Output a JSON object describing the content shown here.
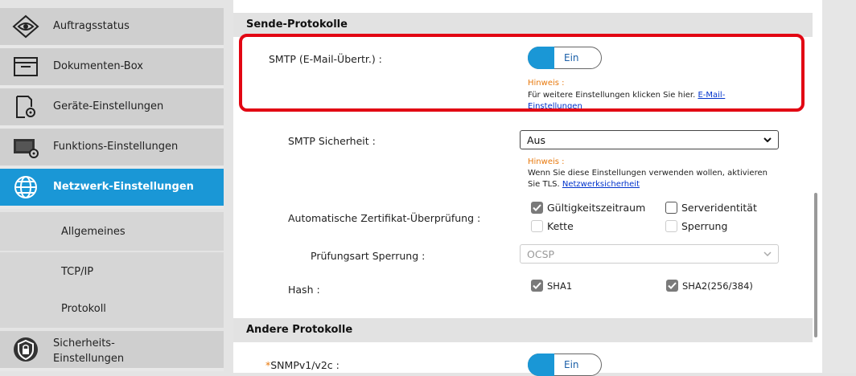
{
  "sidebar": {
    "items": [
      {
        "label": "Auftragsstatus",
        "icon": "eye-icon"
      },
      {
        "label": "Dokumenten-Box",
        "icon": "folder-icon"
      },
      {
        "label": "Geräte-Einstellungen",
        "icon": "device-settings-icon"
      },
      {
        "label": "Funktions-Einstellungen",
        "icon": "function-settings-icon"
      },
      {
        "label": "Netzwerk-Einstellungen",
        "icon": "globe-icon"
      }
    ],
    "sub_items": [
      {
        "label": "Allgemeines"
      },
      {
        "label": "TCP/IP"
      },
      {
        "label": "Protokoll"
      }
    ],
    "security": {
      "label_line1": "Sicherheits-",
      "label_line2": "Einstellungen",
      "icon": "shield-lock-icon"
    }
  },
  "main": {
    "section_send": "Sende-Protokolle",
    "smtp": {
      "label": "SMTP (E-Mail-Übertr.) :",
      "toggle": "Ein",
      "hint_title": "Hinweis :",
      "hint_text": "Für weitere Einstellungen klicken Sie hier.",
      "hint_link": "E-Mail-Einstellungen"
    },
    "smtp_security": {
      "label": "SMTP Sicherheit :",
      "value": "Aus",
      "hint_title": "Hinweis :",
      "hint_text_1": "Wenn Sie diese Einstellungen verwenden wollen, aktivieren",
      "hint_text_2": "Sie TLS.",
      "hint_link": "Netzwerksicherheit"
    },
    "auto_cert": {
      "label": "Automatische Zertifikat-Überprüfung :",
      "opt_validity": "Gültigkeitszeitraum",
      "opt_server_id": "Serveridentität",
      "opt_chain": "Kette",
      "opt_revocation": "Sperrung"
    },
    "revocation_type": {
      "label": "Prüfungsart Sperrung :",
      "value": "OCSP"
    },
    "hash": {
      "label": "Hash :",
      "opt_sha1": "SHA1",
      "opt_sha2": "SHA2(256/384)"
    },
    "section_other": "Andere Protokolle",
    "snmp": {
      "required_mark": "*",
      "label": "SNMPv1/v2c :",
      "toggle": "Ein"
    }
  },
  "colors": {
    "accent": "#1a97d6",
    "hint": "#e8790d",
    "highlight": "#e20613"
  }
}
